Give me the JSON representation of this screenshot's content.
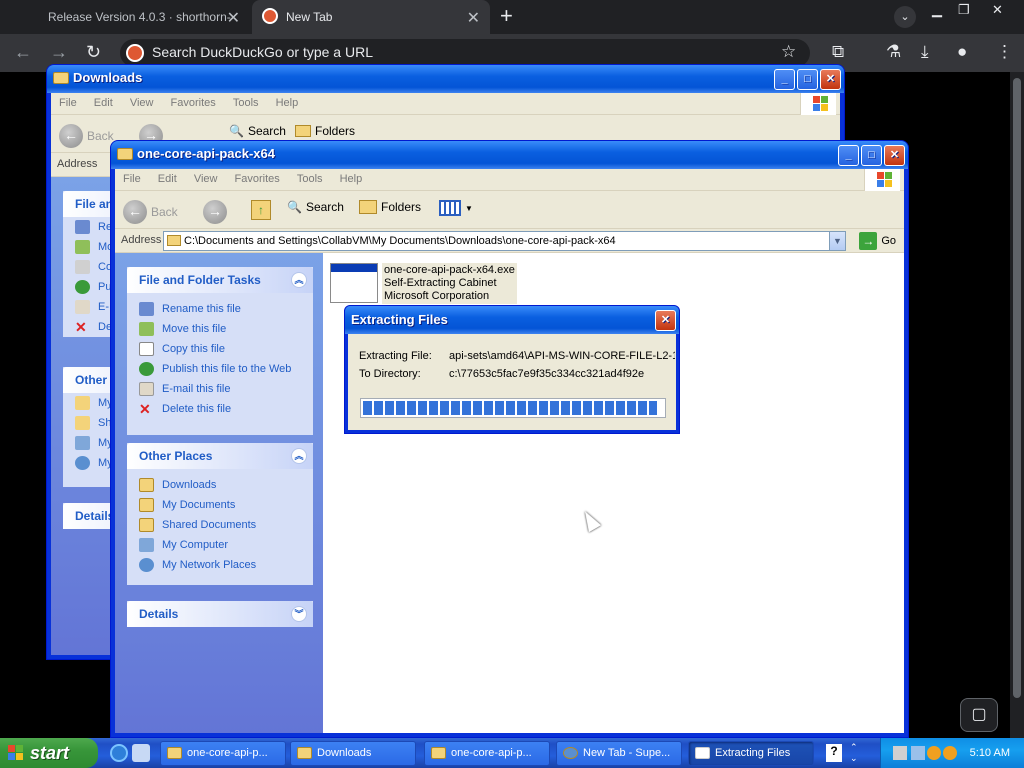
{
  "browser": {
    "tabs": [
      {
        "title": "Release Version 4.0.3 · shorthorn-",
        "active": false
      },
      {
        "title": "New Tab",
        "active": true
      }
    ],
    "new_tab_symbol": "+",
    "omnibox_placeholder": "Search DuckDuckGo or type a URL"
  },
  "back_window": {
    "title": "Downloads",
    "menu": [
      "File",
      "Edit",
      "View",
      "Favorites",
      "Tools",
      "Help"
    ],
    "toolbar": {
      "back": "Back",
      "search": "Search",
      "folders": "Folders"
    },
    "address_label": "Address",
    "tasks_head": "File an",
    "task_labels": [
      "Re",
      "Mo",
      "Co",
      "Pu",
      "E-",
      "De"
    ],
    "other_head": "Other",
    "other_labels": [
      "My",
      "Sh",
      "My",
      "My"
    ],
    "details_head": "Details"
  },
  "front_window": {
    "title": "one-core-api-pack-x64",
    "menu": [
      "File",
      "Edit",
      "View",
      "Favorites",
      "Tools",
      "Help"
    ],
    "toolbar": {
      "back": "Back",
      "search": "Search",
      "folders": "Folders"
    },
    "address_label": "Address",
    "address_value": "C:\\Documents and Settings\\CollabVM\\My Documents\\Downloads\\one-core-api-pack-x64",
    "go_label": "Go",
    "file_tasks": {
      "heading": "File and Folder Tasks",
      "items": [
        "Rename this file",
        "Move this file",
        "Copy this file",
        "Publish this file to the Web",
        "E-mail this file",
        "Delete this file"
      ]
    },
    "other_places": {
      "heading": "Other Places",
      "items": [
        "Downloads",
        "My Documents",
        "Shared Documents",
        "My Computer",
        "My Network Places"
      ]
    },
    "details": {
      "heading": "Details"
    },
    "file": {
      "name": "one-core-api-pack-x64.exe",
      "type": "Self-Extracting Cabinet",
      "company": "Microsoft Corporation"
    }
  },
  "dialog": {
    "title": "Extracting Files",
    "extracting_label": "Extracting File:",
    "extracting_value": "api-sets\\amd64\\API-MS-WIN-CORE-FILE-L2-1-",
    "directory_label": "To Directory:",
    "directory_value": "c:\\77653c5fac7e9f35c334cc321ad4f92e",
    "progress_fraction": 0.98
  },
  "taskbar": {
    "start_label": "start",
    "tasks": [
      {
        "label": "one-core-api-p...",
        "active": false
      },
      {
        "label": "Downloads",
        "active": false
      },
      {
        "label": "one-core-api-p...",
        "active": false
      },
      {
        "label": "New Tab - Supe...",
        "active": false
      },
      {
        "label": "Extracting Files",
        "active": true
      }
    ],
    "clock": "5:10 AM"
  }
}
